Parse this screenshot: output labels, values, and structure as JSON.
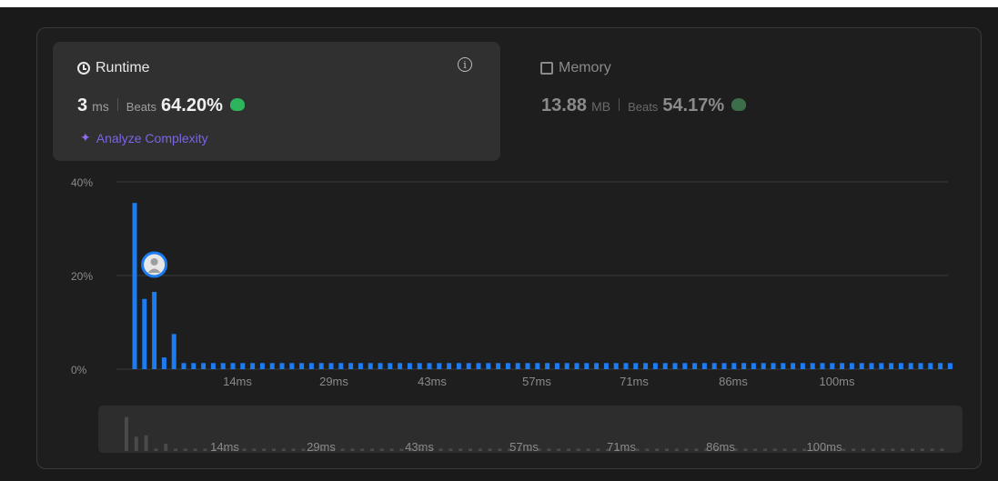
{
  "runtime": {
    "title": "Runtime",
    "value": "3",
    "unit": "ms",
    "beats_label": "Beats",
    "beats_value": "64.20%",
    "analyze_label": "Analyze Complexity",
    "info_icon": "info-icon"
  },
  "memory": {
    "title": "Memory",
    "value": "13.88",
    "unit": "MB",
    "beats_label": "Beats",
    "beats_value": "54.17%"
  },
  "colors": {
    "bar": "#1d7cf2",
    "beats_icon": "#2db55d",
    "analyze": "#7d63e6",
    "grid": "#3a3a3a",
    "scrubber_bar": "#4a4a4a"
  },
  "chart_data": {
    "type": "bar",
    "y_tick_labels": [
      "40%",
      "20%",
      "0%"
    ],
    "ylim": [
      0,
      40
    ],
    "x_tick_labels": [
      "14ms",
      "29ms",
      "43ms",
      "57ms",
      "71ms",
      "86ms",
      "100ms"
    ],
    "values": [
      35.5,
      15,
      16.5,
      2.5,
      7.5,
      1.3,
      1.3,
      1.3,
      1.3,
      1.3,
      1.3,
      1.3,
      1.3,
      1.3,
      1.3,
      1.3,
      1.3,
      1.3,
      1.3,
      1.3,
      1.3,
      1.3,
      1.3,
      1.3,
      1.3,
      1.3,
      1.3,
      1.3,
      1.3,
      1.3,
      1.3,
      1.3,
      1.3,
      1.3,
      1.3,
      1.3,
      1.3,
      1.3,
      1.3,
      1.3,
      1.3,
      1.3,
      1.3,
      1.3,
      1.3,
      1.3,
      1.3,
      1.3,
      1.3,
      1.3,
      1.3,
      1.3,
      1.3,
      1.3,
      1.3,
      1.3,
      1.3,
      1.3,
      1.3,
      1.3,
      1.3,
      1.3,
      1.3,
      1.3,
      1.3,
      1.3,
      1.3,
      1.3,
      1.3,
      1.3,
      1.3,
      1.3,
      1.3,
      1.3,
      1.3,
      1.3,
      1.3,
      1.3,
      1.3,
      1.3,
      1.3,
      1.3,
      1.3,
      1.3
    ],
    "highlight_bar_index": 2,
    "grid": true
  }
}
